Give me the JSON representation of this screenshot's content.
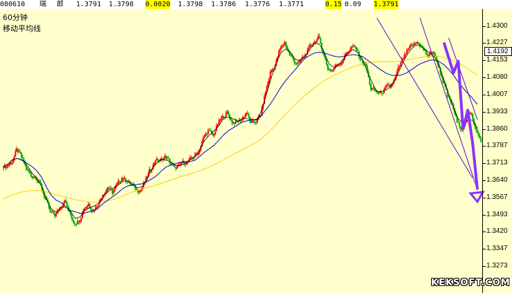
{
  "quote_bar": {
    "code": "080610",
    "name_1": "瑞",
    "name_2": "郎",
    "open": "1.3791",
    "high": "1.3798",
    "change": "0.0020",
    "f4": "1.3798",
    "f5": "1.3786",
    "f6": "1.3776",
    "f7": "1.3771",
    "f8": "0.15",
    "f9": "0.09",
    "f10": "1.3791"
  },
  "chart_title": "60分钟",
  "indicator_label": "移动平均线",
  "current_price": "1.4192",
  "watermark": "KEKSOFT.COM",
  "colors": {
    "background": "#ffffcc",
    "candle_up": "#ff0000",
    "candle_down": "#00aa00",
    "ma_short": "#000000",
    "ma_mid": "#0000cc",
    "ma_long": "#ffcc00",
    "channel": "#6600cc",
    "forecast_arrow": "#8833ff"
  },
  "chart_data": {
    "type": "candlestick",
    "title": "60分钟",
    "indicator": "移动平均线",
    "y_ticks": [
      "1.4300",
      "1.4227",
      "1.4153",
      "1.4080",
      "1.4007",
      "1.3933",
      "1.3860",
      "1.3787",
      "1.3713",
      "1.3640",
      "1.3567",
      "1.3493",
      "1.3420",
      "1.3347",
      "1.3273"
    ],
    "ylim": [
      1.324,
      1.4335
    ],
    "current_price": 1.4192,
    "closes": [
      1.37,
      1.372,
      1.377,
      1.374,
      1.369,
      1.366,
      1.366,
      1.362,
      1.356,
      1.35,
      1.349,
      1.352,
      1.356,
      1.35,
      1.346,
      1.347,
      1.352,
      1.354,
      1.351,
      1.354,
      1.358,
      1.361,
      1.359,
      1.362,
      1.365,
      1.364,
      1.362,
      1.36,
      1.36,
      1.364,
      1.369,
      1.373,
      1.372,
      1.374,
      1.372,
      1.369,
      1.37,
      1.372,
      1.372,
      1.374,
      1.376,
      1.382,
      1.385,
      1.383,
      1.388,
      1.391,
      1.393,
      1.389,
      1.389,
      1.39,
      1.393,
      1.388,
      1.389,
      1.392,
      1.402,
      1.41,
      1.413,
      1.42,
      1.423,
      1.418,
      1.415,
      1.414,
      1.417,
      1.42,
      1.423,
      1.425,
      1.419,
      1.412,
      1.411,
      1.414,
      1.415,
      1.419,
      1.421,
      1.42,
      1.415,
      1.413,
      1.403,
      1.402,
      1.401,
      1.403,
      1.404,
      1.407,
      1.413,
      1.417,
      1.42,
      1.422,
      1.423,
      1.42,
      1.417,
      1.419,
      1.414,
      1.407,
      1.4,
      1.396,
      1.389,
      1.386,
      1.39,
      1.393,
      1.386,
      1.38
    ],
    "ma_short": [
      1.37,
      1.371,
      1.373,
      1.3733,
      1.3727,
      1.3703,
      1.367,
      1.3647,
      1.3613,
      1.356,
      1.3517,
      1.3503,
      1.3523,
      1.3527,
      1.3507,
      1.3477,
      1.3483,
      1.351,
      1.3523,
      1.353,
      1.3543,
      1.3577,
      1.3593,
      1.3607,
      1.362,
      1.3637,
      1.3637,
      1.362,
      1.3607,
      1.3613,
      1.3643,
      1.3687,
      1.3713,
      1.373,
      1.3727,
      1.3717,
      1.3703,
      1.3703,
      1.3713,
      1.3727,
      1.374,
      1.3773,
      1.381,
      1.3833,
      1.3853,
      1.3873,
      1.3907,
      1.391,
      1.3903,
      1.3893,
      1.3907,
      1.3903,
      1.39,
      1.3897,
      1.3943,
      1.4013,
      1.4083,
      1.4143,
      1.4187,
      1.4203,
      1.4187,
      1.4157,
      1.4153,
      1.417,
      1.42,
      1.4227,
      1.4223,
      1.4187,
      1.414,
      1.4123,
      1.4133,
      1.416,
      1.4183,
      1.42,
      1.4187,
      1.416,
      1.4103,
      1.406,
      1.402,
      1.402,
      1.4027,
      1.4047,
      1.408,
      1.4123,
      1.4167,
      1.4197,
      1.4217,
      1.4217,
      1.42,
      1.4187,
      1.4167,
      1.4133,
      1.407,
      1.401,
      1.395,
      1.3903,
      1.3883,
      1.3897,
      1.3897,
      1.3863
    ],
    "ma_mid": [
      1.37,
      1.371,
      1.373,
      1.3733,
      1.3724,
      1.3712,
      1.3698,
      1.368,
      1.3652,
      1.361,
      1.3575,
      1.3555,
      1.3545,
      1.3525,
      1.351,
      1.3505,
      1.3498,
      1.35,
      1.3506,
      1.351,
      1.3525,
      1.3543,
      1.3558,
      1.3572,
      1.3588,
      1.3605,
      1.3616,
      1.362,
      1.3622,
      1.3625,
      1.3634,
      1.3646,
      1.366,
      1.368,
      1.3697,
      1.3705,
      1.3711,
      1.3718,
      1.3718,
      1.372,
      1.3726,
      1.3742,
      1.376,
      1.3775,
      1.379,
      1.3812,
      1.3835,
      1.3852,
      1.3865,
      1.3878,
      1.389,
      1.3895,
      1.3898,
      1.3902,
      1.3921,
      1.3946,
      1.3974,
      1.4006,
      1.404,
      1.4068,
      1.4092,
      1.4115,
      1.414,
      1.4162,
      1.4175,
      1.4185,
      1.4188,
      1.4185,
      1.4178,
      1.4172,
      1.4168,
      1.417,
      1.4175,
      1.4178,
      1.4175,
      1.417,
      1.4155,
      1.414,
      1.4125,
      1.411,
      1.4098,
      1.409,
      1.4088,
      1.409,
      1.4098,
      1.411,
      1.4125,
      1.4138,
      1.4146,
      1.4154,
      1.4155,
      1.4148,
      1.4135,
      1.4115,
      1.409,
      1.406,
      1.4035,
      1.4012,
      1.399,
      1.3965
    ],
    "ma_long": [
      1.356,
      1.357,
      1.3578,
      1.3585,
      1.359,
      1.3594,
      1.3596,
      1.3596,
      1.3594,
      1.359,
      1.3584,
      1.3578,
      1.3573,
      1.3568,
      1.3562,
      1.3557,
      1.3553,
      1.355,
      1.3548,
      1.3547,
      1.3547,
      1.3549,
      1.3553,
      1.3558,
      1.3565,
      1.3573,
      1.3582,
      1.359,
      1.3597,
      1.3603,
      1.3609,
      1.3614,
      1.362,
      1.3627,
      1.3634,
      1.3641,
      1.3648,
      1.3655,
      1.3661,
      1.3667,
      1.3673,
      1.368,
      1.3688,
      1.3697,
      1.3707,
      1.3717,
      1.3728,
      1.3739,
      1.375,
      1.3761,
      1.3772,
      1.3783,
      1.3794,
      1.3805,
      1.382,
      1.3838,
      1.3858,
      1.388,
      1.3903,
      1.3925,
      1.3946,
      1.3966,
      1.3985,
      1.4003,
      1.402,
      1.4037,
      1.4052,
      1.4066,
      1.4078,
      1.4089,
      1.4099,
      1.4108,
      1.4117,
      1.4125,
      1.4132,
      1.4138,
      1.4142,
      1.4145,
      1.4147,
      1.4148,
      1.4148,
      1.4148,
      1.4149,
      1.4151,
      1.4154,
      1.4158,
      1.4162,
      1.4166,
      1.417,
      1.4172,
      1.4172,
      1.417,
      1.4166,
      1.416,
      1.4152,
      1.4142,
      1.4131,
      1.4118,
      1.4104,
      1.409
    ]
  }
}
